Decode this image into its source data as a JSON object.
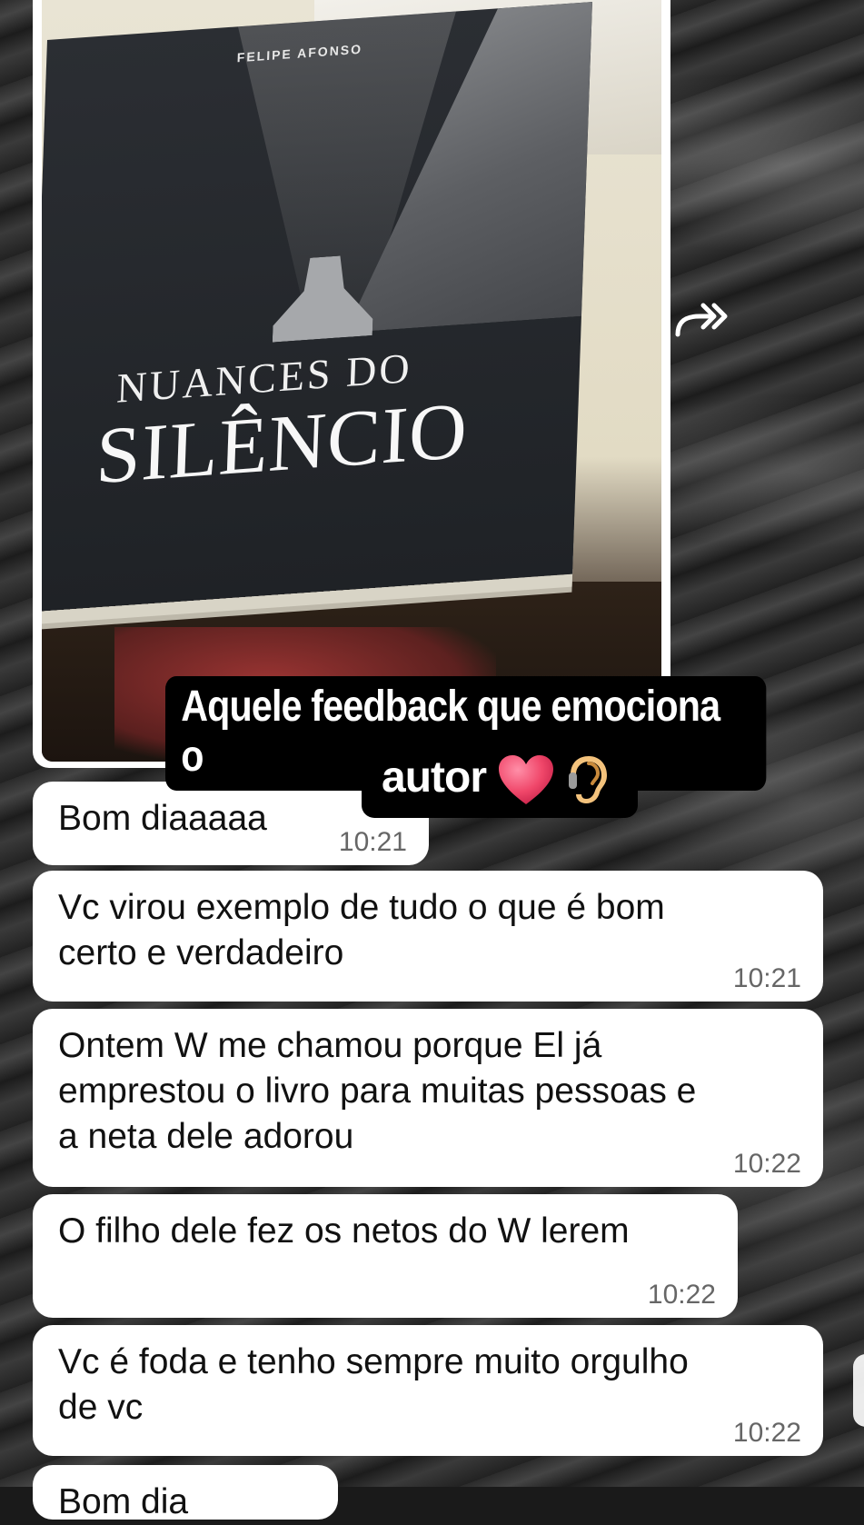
{
  "photo": {
    "book_author": "FELIPE AFONSO",
    "book_title_line1": "NUANCES DO",
    "book_title_line2": "SILÊNCIO"
  },
  "caption": {
    "line1": "Aquele feedback que emociona o",
    "line2": "autor",
    "emojis": [
      "heart-icon",
      "ear-with-hearing-aid-icon"
    ]
  },
  "messages": [
    {
      "text": "Bom diaaaaa",
      "time": "10:21"
    },
    {
      "text": "Vc virou exemplo de tudo o que é bom\ncerto e verdadeiro",
      "time": "10:21"
    },
    {
      "text": "Ontem W me chamou porque El já\nemprestou o livro para muitas pessoas e\na neta dele adorou",
      "time": "10:22"
    },
    {
      "text": "O filho dele fez os netos do W lerem",
      "time": "10:22"
    },
    {
      "text": "Vc é foda e tenho sempre muito orgulho\nde vc",
      "time": "10:22"
    },
    {
      "text": "Bom dia",
      "time": ""
    }
  ],
  "colors": {
    "bubble": "#ffffff",
    "caption_bg": "#000000",
    "heart": "#f0476a"
  }
}
